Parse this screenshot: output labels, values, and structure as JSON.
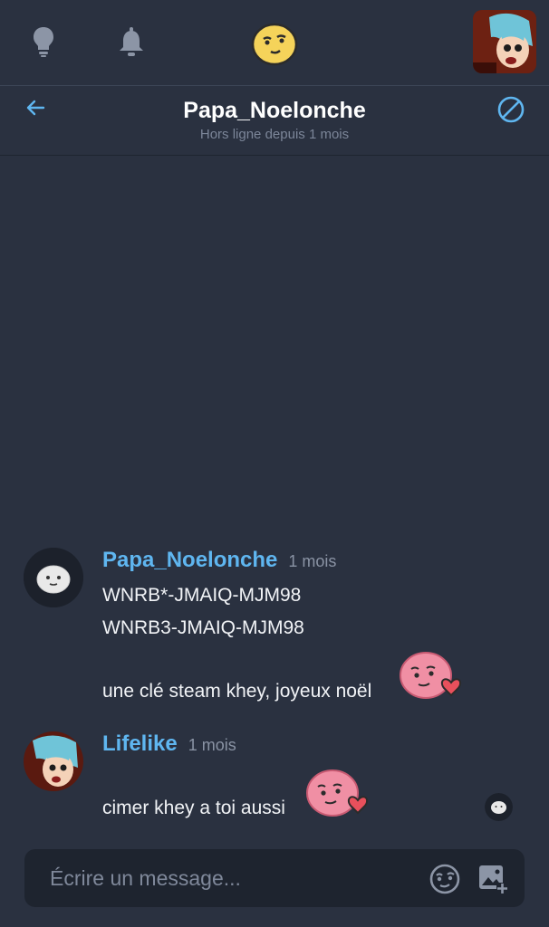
{
  "topbar": {
    "icons": [
      "lightbulb-icon",
      "bell-icon",
      "smiley-sticker-icon",
      "user-avatar"
    ]
  },
  "conversation": {
    "title": "Papa_Noelonche",
    "status": "Hors ligne depuis 1 mois"
  },
  "messages": [
    {
      "author": "Papa_Noelonche",
      "time": "1 mois",
      "lines": [
        "WNRB*-JMAIQ-MJM98",
        "WNRB3-JMAIQ-MJM98",
        "une clé steam khey, joyeux noël"
      ]
    },
    {
      "author": "Lifelike",
      "time": "1 mois",
      "lines": [
        "cimer khey a toi aussi"
      ]
    }
  ],
  "composer": {
    "placeholder": "Écrire un message..."
  },
  "colors": {
    "background": "#2a3140",
    "accent": "#5fb6f0",
    "input_background": "#1e242f"
  }
}
